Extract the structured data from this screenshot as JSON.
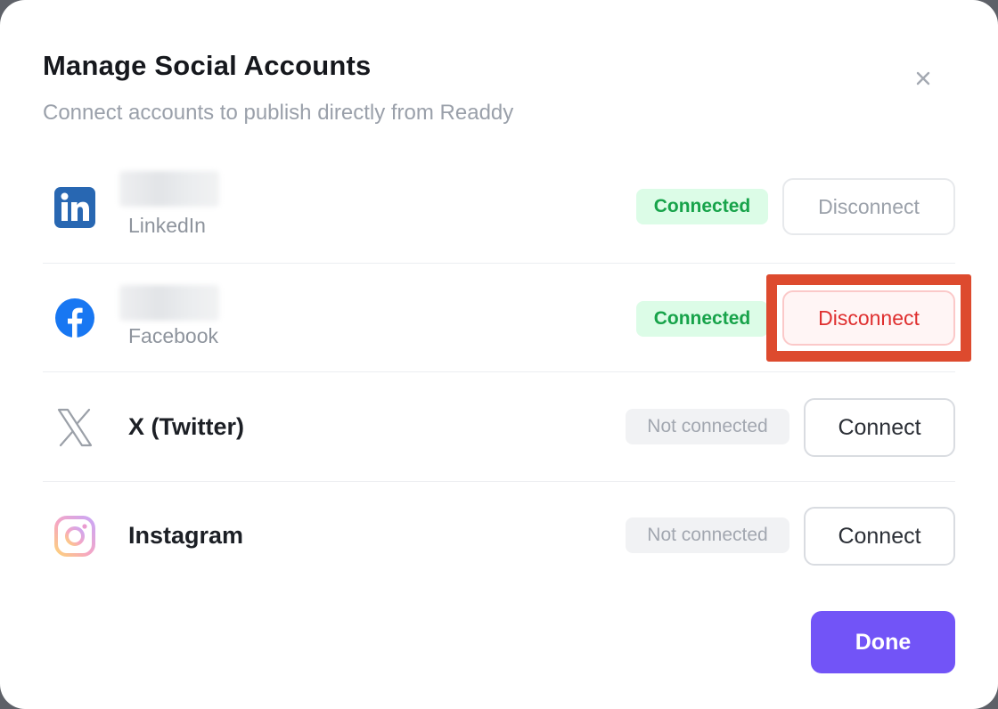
{
  "modal": {
    "title": "Manage Social Accounts",
    "subtitle": "Connect accounts to publish directly from Readdy",
    "close_icon": "close-icon",
    "done_label": "Done"
  },
  "accounts": [
    {
      "platform": "LinkedIn",
      "icon": "linkedin-icon",
      "status": "Connected",
      "action": "Disconnect",
      "account_name_obscured": true
    },
    {
      "platform": "Facebook",
      "icon": "facebook-icon",
      "status": "Connected",
      "action": "Disconnect",
      "account_name_obscured": true,
      "highlighted": true
    },
    {
      "platform": "X (Twitter)",
      "icon": "x-twitter-icon",
      "status": "Not connected",
      "action": "Connect"
    },
    {
      "platform": "Instagram",
      "icon": "instagram-icon",
      "status": "Not connected",
      "action": "Connect"
    }
  ],
  "colors": {
    "primary": "#7254f7",
    "connected_bg": "#dcfce7",
    "connected_text": "#17a34a",
    "disconnect_text": "#df2f2f",
    "highlight": "#dd4a2e",
    "linkedin": "#2867b2",
    "facebook": "#1877f2"
  }
}
